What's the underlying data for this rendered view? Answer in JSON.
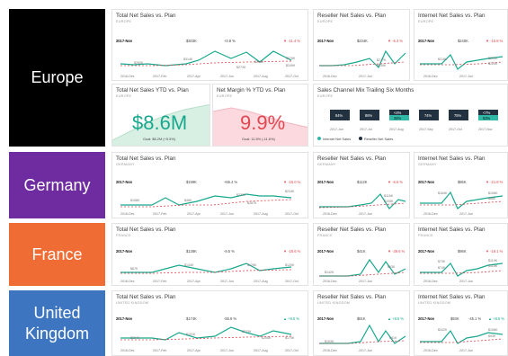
{
  "rows": [
    {
      "region": "Europe",
      "sub": "EUROPE",
      "color": "#000000"
    },
    {
      "region": "Germany",
      "sub": "GERMANY",
      "color": "#6f2ca1"
    },
    {
      "region": "France",
      "sub": "FRANCE",
      "color": "#ef6c35"
    },
    {
      "region": "United Kingdom",
      "sub": "UNITED KINGDOM",
      "color": "#3e75c1"
    }
  ],
  "titles": {
    "total": "Total Net Sales vs. Plan",
    "reseller": "Reseller Net Sales vs. Plan",
    "internet": "Internet Net Sales vs. Plan",
    "ytd": "Total Net Sales YTD vs. Plan",
    "margin": "Net Margin % YTD vs. Plan",
    "mix": "Sales Channel Mix Trailing Six Months"
  },
  "period": "2017-Nov",
  "tiles": {
    "europe_total": {
      "a": "$303K",
      "b": "+3.8 %",
      "c": "▼ -11.4 %",
      "pts": [
        "$260K",
        "$314K",
        "$273K",
        "$295K",
        "$276K",
        "$249K"
      ],
      "x": [
        "2016-Dec",
        "2017-Feb",
        "2017-Apr",
        "2017-Jun",
        "2017-Aug",
        "2017-Oct"
      ]
    },
    "europe_reseller": {
      "a": "$234K",
      "c": "▼ -6.3 %",
      "pts": [
        "$277K",
        "$239K"
      ],
      "x": [
        "2016-Dec",
        "2017-Jun"
      ]
    },
    "europe_internet": {
      "a": "$240K",
      "c": "▼ -15.8 %",
      "pts": [
        "$218K",
        "$204K",
        "$225K"
      ],
      "x": [
        "2016-Dec",
        "2017-Jun"
      ]
    },
    "europe_ytd": {
      "value": "$8.6M",
      "goal": "Goal: $8.2M (+5.5%)"
    },
    "europe_margin": {
      "value": "9.9%",
      "goal": "Goal: 11.5% (-11.6%)"
    },
    "europe_mix": {
      "bars": [
        {
          "top": "",
          "bottom": "",
          "label": "84%"
        },
        {
          "top": "",
          "bottom": "",
          "label": "86%"
        },
        {
          "top": "<4%",
          "bottom": "34%",
          "label": ""
        },
        {
          "top": "",
          "bottom": "",
          "label": "74%"
        },
        {
          "top": "",
          "bottom": "",
          "label": "75%"
        },
        {
          "top": "<7%",
          "bottom": "53%",
          "label": ""
        }
      ],
      "x": [
        "2017-Jun",
        "2017-Jul",
        "2017-Aug",
        "2017-Sep",
        "2017-Oct",
        "2017-Nov"
      ],
      "legend": [
        "Internet Net Sales",
        "Reseller Net Sales"
      ],
      "colors": {
        "dark": "#233240",
        "teal": "#2fb8a6"
      }
    },
    "germany_total": {
      "a": "$199K",
      "b": "+65.4 %",
      "c": "▼ -15.0 %",
      "pts": [
        "$158K",
        "$48K",
        "$227K",
        "$234K",
        "$287K"
      ],
      "x": [
        "2016-Dec",
        "2017-Feb",
        "2017-Apr",
        "2017-Jun",
        "2017-Aug",
        "2017-Oct"
      ]
    },
    "germany_reseller": {
      "a": "$112K",
      "c": "▼ -6.6 %",
      "pts": [
        "$116K",
        "$105K"
      ],
      "x": [
        "2016-Dec",
        "2017-Jun"
      ]
    },
    "germany_internet": {
      "a": "$86K",
      "c": "▼ -21.8 %",
      "pts": [
        "$164K",
        "$108K",
        "$86K"
      ],
      "x": [
        "2016-Dec",
        "2017-Jun"
      ]
    },
    "france_total": {
      "a": "$138K",
      "b": "-9.5 %",
      "c": "▼ -18.6 %",
      "pts": [
        "$87K",
        "$134K",
        "$125K",
        "$120K"
      ],
      "x": [
        "2016-Dec",
        "2017-Feb",
        "2017-Apr",
        "2017-Jun",
        "2017-Aug",
        "2017-Oct"
      ]
    },
    "france_reseller": {
      "a": "$41K",
      "c": "▼ -39.6 %",
      "pts": [
        "$142K",
        "$63K"
      ],
      "x": [
        "2016-Dec",
        "2017-Jun"
      ]
    },
    "france_internet": {
      "a": "$96K",
      "c": "▼ -19.1 %",
      "pts": [
        "$73K",
        "$74K",
        "$110K",
        "$118K"
      ],
      "x": [
        "2016-Dec",
        "2017-Jun"
      ]
    },
    "uk_total": {
      "a": "$174K",
      "b": "-55.9 %",
      "c": "▲ +8.5 %",
      "pts": [
        "$294K",
        "$191K",
        "$233K",
        "$206K",
        "$174K"
      ],
      "x": [
        "2016-Dec",
        "2017-Feb",
        "2017-Apr",
        "2017-Jun",
        "2017-Aug",
        "2017-Oct"
      ]
    },
    "uk_reseller": {
      "a": "$81K",
      "c": "▲ +8.5 %",
      "pts": [
        "$153K",
        "$81K"
      ],
      "x": [
        "2016-Dec",
        "2017-Jun"
      ]
    },
    "uk_internet": {
      "a": "$93K",
      "b": "-45.1 %",
      "c": "▲ +8.5 %",
      "pts": [
        "$342K",
        "$108K",
        "$93K"
      ],
      "x": [
        "2016-Dec",
        "2017-Jun"
      ]
    }
  }
}
